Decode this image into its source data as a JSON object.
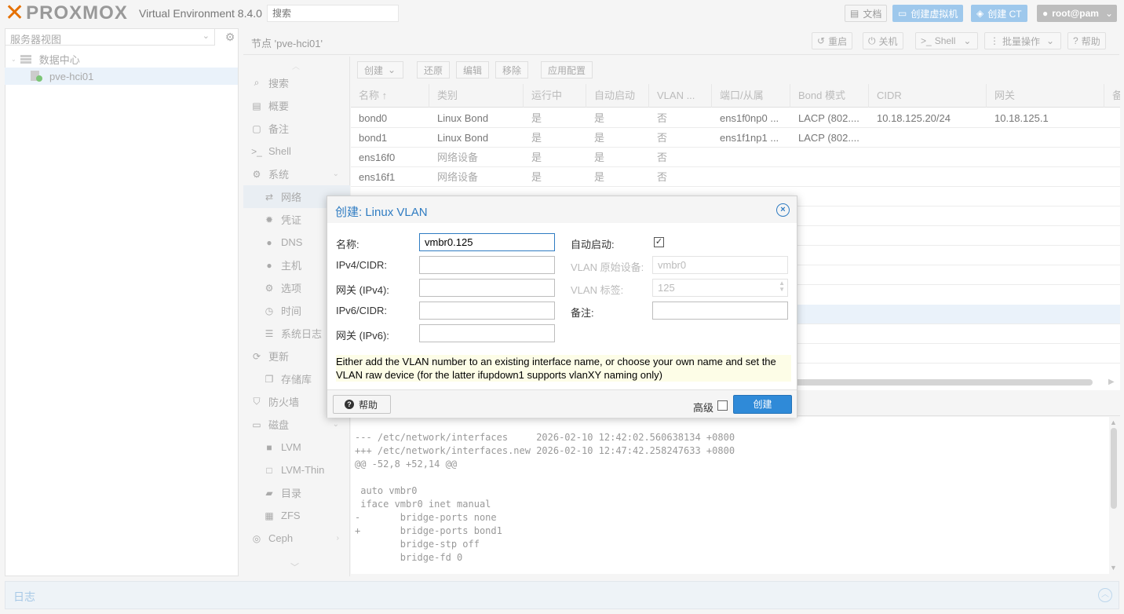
{
  "header": {
    "brand": "PROXMOX",
    "version": "Virtual Environment 8.4.0",
    "search_placeholder": "搜索",
    "docs": "文档",
    "create_vm": "创建虚拟机",
    "create_ct": "创建 CT",
    "user": "root@pam"
  },
  "tree": {
    "view": "服务器视图",
    "datacenter": "数据中心",
    "node": "pve-hci01"
  },
  "node_toolbar": {
    "title": "节点 'pve-hci01'",
    "reboot": "重启",
    "shutdown": "关机",
    "shell": "Shell",
    "bulk": "批量操作",
    "help": "帮助"
  },
  "nav": {
    "items": [
      "搜索",
      "概要",
      "备注",
      "Shell",
      "系统",
      "网络",
      "凭证",
      "DNS",
      "主机",
      "选项",
      "时间",
      "系统日志",
      "更新",
      "存储库",
      "防火墙",
      "磁盘",
      "LVM",
      "LVM-Thin",
      "目录",
      "ZFS",
      "Ceph"
    ]
  },
  "grid_toolbar": {
    "create": "创建",
    "revert": "还原",
    "edit": "编辑",
    "remove": "移除",
    "apply": "应用配置"
  },
  "grid": {
    "columns": [
      "名称 ↑",
      "类别",
      "运行中",
      "自动启动",
      "VLAN ...",
      "端口/从属",
      "Bond 模式",
      "CIDR",
      "网关",
      "备"
    ],
    "rows": [
      [
        "bond0",
        "Linux Bond",
        "是",
        "是",
        "否",
        "ens1f0np0 ...",
        "LACP (802....",
        "10.18.125.20/24",
        "10.18.125.1"
      ],
      [
        "bond1",
        "Linux Bond",
        "是",
        "是",
        "否",
        "ens1f1np1 ...",
        "LACP (802....",
        "",
        ""
      ],
      [
        "ens16f0",
        "网络设备",
        "是",
        "是",
        "否",
        "",
        "",
        "",
        ""
      ],
      [
        "ens16f1",
        "网络设备",
        "是",
        "是",
        "否",
        "",
        "",
        "",
        ""
      ]
    ]
  },
  "diff": {
    "lines": [
      "--- /etc/network/interfaces     2026-02-10 12:42:02.560638134 +0800",
      "+++ /etc/network/interfaces.new 2026-02-10 12:47:42.258247633 +0800",
      "@@ -52,8 +52,14 @@",
      "",
      " auto vmbr0",
      " iface vmbr0 inet manual",
      "-       bridge-ports none",
      "+       bridge-ports bond1",
      "        bridge-stp off",
      "        bridge-fd 0"
    ]
  },
  "log": {
    "title": "日志"
  },
  "dialog": {
    "title": "创建: Linux VLAN",
    "name_label": "名称:",
    "name_value": "vmbr0.125",
    "ipv4_label": "IPv4/CIDR:",
    "gw4_label": "网关 (IPv4):",
    "ipv6_label": "IPv6/CIDR:",
    "gw6_label": "网关 (IPv6):",
    "autostart_label": "自动启动:",
    "autostart_checked": "✓",
    "raw_label": "VLAN 原始设备:",
    "raw_value": "vmbr0",
    "tag_label": "VLAN 标签:",
    "tag_value": "125",
    "comment_label": "备注:",
    "hint": "Either add the VLAN number to an existing interface name, or choose your own name and set the VLAN raw device (for the latter ifupdown1 supports vlanXY naming only)",
    "help": "帮助",
    "advanced": "高级",
    "create": "创建"
  }
}
